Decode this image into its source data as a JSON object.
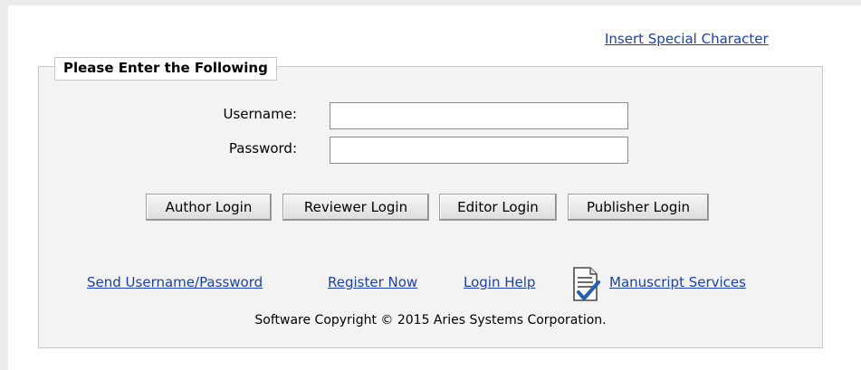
{
  "header": {
    "special_char_link": "Insert Special Character"
  },
  "login_form": {
    "legend": "Please Enter the Following",
    "username": {
      "label": "Username:",
      "value": "",
      "placeholder": ""
    },
    "password": {
      "label": "Password:",
      "value": "",
      "placeholder": ""
    },
    "buttons": {
      "author": "Author Login",
      "reviewer": "Reviewer Login",
      "editor": "Editor Login",
      "publisher": "Publisher Login"
    },
    "links": {
      "send_credentials": "Send Username/Password",
      "register": "Register Now",
      "help": "Login Help",
      "manuscript_services": "Manuscript Services"
    },
    "copyright": "Software Copyright © 2015 Aries Systems Corporation."
  },
  "colors": {
    "link": "#1a3fb8",
    "icon_check": "#1f5fb5"
  },
  "icons": {
    "manuscript_services": "document-check-icon"
  }
}
